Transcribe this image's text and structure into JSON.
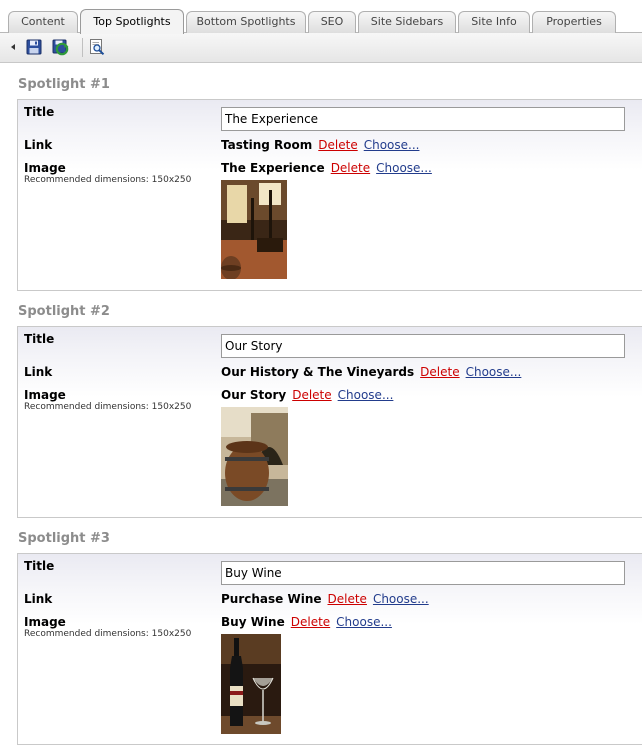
{
  "tabs": [
    {
      "label": "Content",
      "active": false
    },
    {
      "label": "Top Spotlights",
      "active": true
    },
    {
      "label": "Bottom Spotlights",
      "active": false
    },
    {
      "label": "SEO",
      "active": false
    },
    {
      "label": "Site Sidebars",
      "active": false
    },
    {
      "label": "Site Info",
      "active": false
    },
    {
      "label": "Properties",
      "active": false
    }
  ],
  "toolbar": {
    "icons": [
      "collapse-arrow-icon",
      "save-icon",
      "save-publish-icon",
      "preview-icon"
    ]
  },
  "labels": {
    "title": "Title",
    "link": "Link",
    "image": "Image",
    "recommended": "Recommended dimensions: 150x250",
    "delete": "Delete",
    "choose": "Choose..."
  },
  "spotlights": [
    {
      "heading": "Spotlight #1",
      "title_value": "The Experience",
      "link_value": "Tasting Room",
      "image_value": "The Experience"
    },
    {
      "heading": "Spotlight #2",
      "title_value": "Our Story",
      "link_value": "Our History & The Vineyards",
      "image_value": "Our Story"
    },
    {
      "heading": "Spotlight #3",
      "title_value": "Buy Wine",
      "link_value": "Purchase Wine",
      "image_value": "Buy Wine"
    }
  ]
}
